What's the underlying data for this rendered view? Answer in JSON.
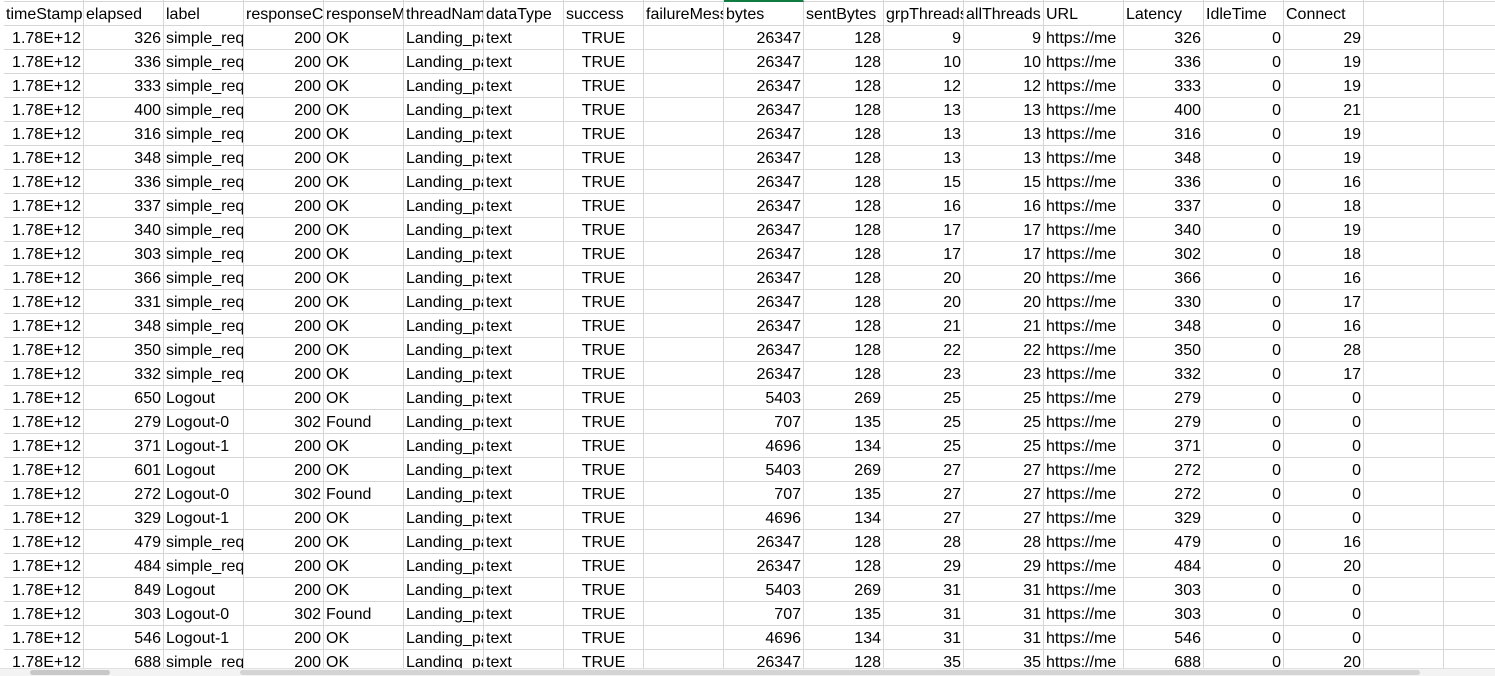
{
  "sheet": {
    "columns": [
      {
        "header": "timeStamp",
        "align": "num"
      },
      {
        "header": "elapsed",
        "align": "num"
      },
      {
        "header": "label",
        "align": "left"
      },
      {
        "header": "responseCode",
        "align": "num"
      },
      {
        "header": "responseMessage",
        "align": "left"
      },
      {
        "header": "threadName",
        "align": "left"
      },
      {
        "header": "dataType",
        "align": "left"
      },
      {
        "header": "success",
        "align": "center"
      },
      {
        "header": "failureMessage",
        "align": "left"
      },
      {
        "header": "bytes",
        "align": "num"
      },
      {
        "header": "sentBytes",
        "align": "num"
      },
      {
        "header": "grpThreads",
        "align": "num"
      },
      {
        "header": "allThreads",
        "align": "num"
      },
      {
        "header": "URL",
        "align": "left"
      },
      {
        "header": "Latency",
        "align": "num"
      },
      {
        "header": "IdleTime",
        "align": "num"
      },
      {
        "header": "Connect",
        "align": "num"
      },
      {
        "header": "",
        "align": "left"
      },
      {
        "header": "",
        "align": "left"
      }
    ],
    "rows": [
      [
        "1.78E+12",
        "326",
        "simple_request",
        "200",
        "OK",
        "Landing_page",
        "text",
        "TRUE",
        "",
        "26347",
        "128",
        "9",
        "9",
        "https://me",
        "326",
        "0",
        "29"
      ],
      [
        "1.78E+12",
        "336",
        "simple_request",
        "200",
        "OK",
        "Landing_page",
        "text",
        "TRUE",
        "",
        "26347",
        "128",
        "10",
        "10",
        "https://me",
        "336",
        "0",
        "19"
      ],
      [
        "1.78E+12",
        "333",
        "simple_request",
        "200",
        "OK",
        "Landing_page",
        "text",
        "TRUE",
        "",
        "26347",
        "128",
        "12",
        "12",
        "https://me",
        "333",
        "0",
        "19"
      ],
      [
        "1.78E+12",
        "400",
        "simple_request",
        "200",
        "OK",
        "Landing_page",
        "text",
        "TRUE",
        "",
        "26347",
        "128",
        "13",
        "13",
        "https://me",
        "400",
        "0",
        "21"
      ],
      [
        "1.78E+12",
        "316",
        "simple_request",
        "200",
        "OK",
        "Landing_page",
        "text",
        "TRUE",
        "",
        "26347",
        "128",
        "13",
        "13",
        "https://me",
        "316",
        "0",
        "19"
      ],
      [
        "1.78E+12",
        "348",
        "simple_request",
        "200",
        "OK",
        "Landing_page",
        "text",
        "TRUE",
        "",
        "26347",
        "128",
        "13",
        "13",
        "https://me",
        "348",
        "0",
        "19"
      ],
      [
        "1.78E+12",
        "336",
        "simple_request",
        "200",
        "OK",
        "Landing_page",
        "text",
        "TRUE",
        "",
        "26347",
        "128",
        "15",
        "15",
        "https://me",
        "336",
        "0",
        "16"
      ],
      [
        "1.78E+12",
        "337",
        "simple_request",
        "200",
        "OK",
        "Landing_page",
        "text",
        "TRUE",
        "",
        "26347",
        "128",
        "16",
        "16",
        "https://me",
        "337",
        "0",
        "18"
      ],
      [
        "1.78E+12",
        "340",
        "simple_request",
        "200",
        "OK",
        "Landing_page",
        "text",
        "TRUE",
        "",
        "26347",
        "128",
        "17",
        "17",
        "https://me",
        "340",
        "0",
        "19"
      ],
      [
        "1.78E+12",
        "303",
        "simple_request",
        "200",
        "OK",
        "Landing_page",
        "text",
        "TRUE",
        "",
        "26347",
        "128",
        "17",
        "17",
        "https://me",
        "302",
        "0",
        "18"
      ],
      [
        "1.78E+12",
        "366",
        "simple_request",
        "200",
        "OK",
        "Landing_page",
        "text",
        "TRUE",
        "",
        "26347",
        "128",
        "20",
        "20",
        "https://me",
        "366",
        "0",
        "16"
      ],
      [
        "1.78E+12",
        "331",
        "simple_request",
        "200",
        "OK",
        "Landing_page",
        "text",
        "TRUE",
        "",
        "26347",
        "128",
        "20",
        "20",
        "https://me",
        "330",
        "0",
        "17"
      ],
      [
        "1.78E+12",
        "348",
        "simple_request",
        "200",
        "OK",
        "Landing_page",
        "text",
        "TRUE",
        "",
        "26347",
        "128",
        "21",
        "21",
        "https://me",
        "348",
        "0",
        "16"
      ],
      [
        "1.78E+12",
        "350",
        "simple_request",
        "200",
        "OK",
        "Landing_page",
        "text",
        "TRUE",
        "",
        "26347",
        "128",
        "22",
        "22",
        "https://me",
        "350",
        "0",
        "28"
      ],
      [
        "1.78E+12",
        "332",
        "simple_request",
        "200",
        "OK",
        "Landing_page",
        "text",
        "TRUE",
        "",
        "26347",
        "128",
        "23",
        "23",
        "https://me",
        "332",
        "0",
        "17"
      ],
      [
        "1.78E+12",
        "650",
        "Logout",
        "200",
        "OK",
        "Landing_page",
        "text",
        "TRUE",
        "",
        "5403",
        "269",
        "25",
        "25",
        "https://me",
        "279",
        "0",
        "0"
      ],
      [
        "1.78E+12",
        "279",
        "Logout-0",
        "302",
        "Found",
        "Landing_page",
        "text",
        "TRUE",
        "",
        "707",
        "135",
        "25",
        "25",
        "https://me",
        "279",
        "0",
        "0"
      ],
      [
        "1.78E+12",
        "371",
        "Logout-1",
        "200",
        "OK",
        "Landing_page",
        "text",
        "TRUE",
        "",
        "4696",
        "134",
        "25",
        "25",
        "https://me",
        "371",
        "0",
        "0"
      ],
      [
        "1.78E+12",
        "601",
        "Logout",
        "200",
        "OK",
        "Landing_page",
        "text",
        "TRUE",
        "",
        "5403",
        "269",
        "27",
        "27",
        "https://me",
        "272",
        "0",
        "0"
      ],
      [
        "1.78E+12",
        "272",
        "Logout-0",
        "302",
        "Found",
        "Landing_page",
        "text",
        "TRUE",
        "",
        "707",
        "135",
        "27",
        "27",
        "https://me",
        "272",
        "0",
        "0"
      ],
      [
        "1.78E+12",
        "329",
        "Logout-1",
        "200",
        "OK",
        "Landing_page",
        "text",
        "TRUE",
        "",
        "4696",
        "134",
        "27",
        "27",
        "https://me",
        "329",
        "0",
        "0"
      ],
      [
        "1.78E+12",
        "479",
        "simple_request",
        "200",
        "OK",
        "Landing_page",
        "text",
        "TRUE",
        "",
        "26347",
        "128",
        "28",
        "28",
        "https://me",
        "479",
        "0",
        "16"
      ],
      [
        "1.78E+12",
        "484",
        "simple_request",
        "200",
        "OK",
        "Landing_page",
        "text",
        "TRUE",
        "",
        "26347",
        "128",
        "29",
        "29",
        "https://me",
        "484",
        "0",
        "20"
      ],
      [
        "1.78E+12",
        "849",
        "Logout",
        "200",
        "OK",
        "Landing_page",
        "text",
        "TRUE",
        "",
        "5403",
        "269",
        "31",
        "31",
        "https://me",
        "303",
        "0",
        "0"
      ],
      [
        "1.78E+12",
        "303",
        "Logout-0",
        "302",
        "Found",
        "Landing_page",
        "text",
        "TRUE",
        "",
        "707",
        "135",
        "31",
        "31",
        "https://me",
        "303",
        "0",
        "0"
      ],
      [
        "1.78E+12",
        "546",
        "Logout-1",
        "200",
        "OK",
        "Landing_page",
        "text",
        "TRUE",
        "",
        "4696",
        "134",
        "31",
        "31",
        "https://me",
        "546",
        "0",
        "0"
      ],
      [
        "1.78E+12",
        "688",
        "simple_request",
        "200",
        "OK",
        "Landing_page",
        "text",
        "TRUE",
        "",
        "26347",
        "128",
        "35",
        "35",
        "https://me",
        "688",
        "0",
        "20"
      ]
    ],
    "selected_column_index": 9,
    "colors": {
      "gridline": "#d6d6d6",
      "selection": "#107c41"
    }
  }
}
